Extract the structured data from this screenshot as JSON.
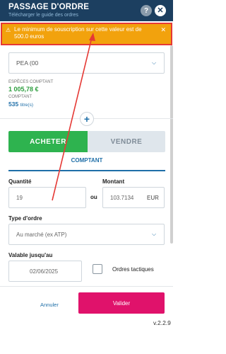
{
  "header": {
    "title": "PASSAGE D'ORDRE",
    "subtitle": "Télécharger le guide des ordres",
    "help_label": "?",
    "close_label": "✕"
  },
  "alert": {
    "icon": "⚠",
    "message": "Le minimum de souscription sur cette valeur est de 500.0 euros",
    "close_label": "✕"
  },
  "account": {
    "value": "PEA (00",
    "cash_label": "ESPÈCES COMPTANT",
    "cash_value": "1 005,78 €",
    "titles_label": "COMPTANT",
    "titles_value": "535",
    "titles_unit": "titre(s)"
  },
  "plus_label": "+",
  "side": {
    "buy_label": "ACHETER",
    "sell_label": "VENDRE"
  },
  "tab": {
    "label": "COMPTANT"
  },
  "quantity": {
    "label": "Quantité",
    "value": "19"
  },
  "or_label": "ou",
  "amount": {
    "label": "Montant",
    "value": "103.7134",
    "currency": "EUR"
  },
  "order_type": {
    "label": "Type d'ordre",
    "value": "Au marché (ex ATP)"
  },
  "validity": {
    "label": "Valable jusqu'au",
    "date": "02/06/2025",
    "tactical_label": "Ordres tactiques"
  },
  "footer": {
    "cancel_label": "Annuler",
    "validate_label": "Valider",
    "version": "v.2.2.9"
  },
  "colors": {
    "header_bg": "#1c3f60",
    "alert_bg": "#f2a20d",
    "alert_border": "#e53935",
    "buy": "#2eb34f",
    "validate": "#e0126b",
    "accent": "#1f6fa8"
  }
}
